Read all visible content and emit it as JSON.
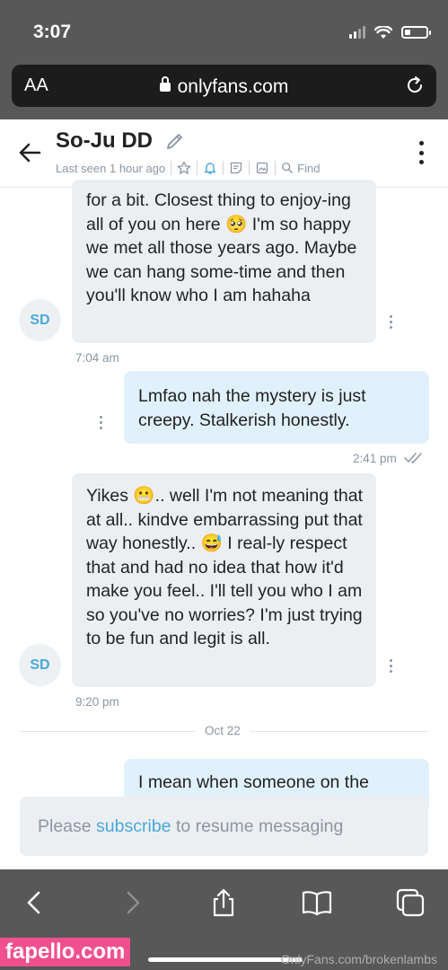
{
  "status_bar": {
    "time": "3:07"
  },
  "browser": {
    "text_size_label": "AA",
    "url": "onlyfans.com"
  },
  "chat": {
    "contact_name": "So-Ju DD",
    "last_seen": "Last seen 1 hour ago",
    "find_label": "Find",
    "messages": [
      {
        "side": "in",
        "text": "for a bit. Closest thing to enjoy-ing all of you on here 🥺 I'm so happy we met all those years ago. Maybe we can hang some-time and then you'll know who I am hahaha",
        "avatar": "SD",
        "time": "7:04 am"
      },
      {
        "side": "out",
        "text": "Lmfao nah the mystery is just creepy. Stalkerish honestly.",
        "time": "2:41 pm"
      },
      {
        "side": "in",
        "text": "Yikes 😬.. well I'm not meaning that at all.. kindve embarrassing put that way honestly.. 😅 I real-ly respect that and had no idea that how it'd make you feel.. I'll tell you who I am so you've no worries? I'm just trying to be fun and legit is all.",
        "avatar": "SD",
        "time": "9:20 pm"
      },
      {
        "side": "out",
        "text": "I mean when someone on the"
      }
    ],
    "date_divider": "Oct 22",
    "banner": {
      "prefix": "Please",
      "link": "subscribe",
      "suffix": "to resume messaging"
    }
  },
  "watermarks": {
    "left": "fapello.com",
    "right": "OnlyFans.com/brokenlambs"
  },
  "colors": {
    "accent": "#4aa8dc",
    "incoming_bubble": "#eceff1",
    "outgoing_bubble": "#e1f1fb",
    "chrome": "#585858"
  },
  "icons": [
    "back-arrow-icon",
    "pencil-icon",
    "star-icon",
    "bell-icon",
    "notes-icon",
    "image-icon",
    "search-icon",
    "more-icon",
    "lock-icon",
    "reload-icon",
    "chevron-left-icon",
    "chevron-right-icon",
    "share-icon",
    "book-icon",
    "tabs-icon",
    "read-receipt-icon"
  ]
}
